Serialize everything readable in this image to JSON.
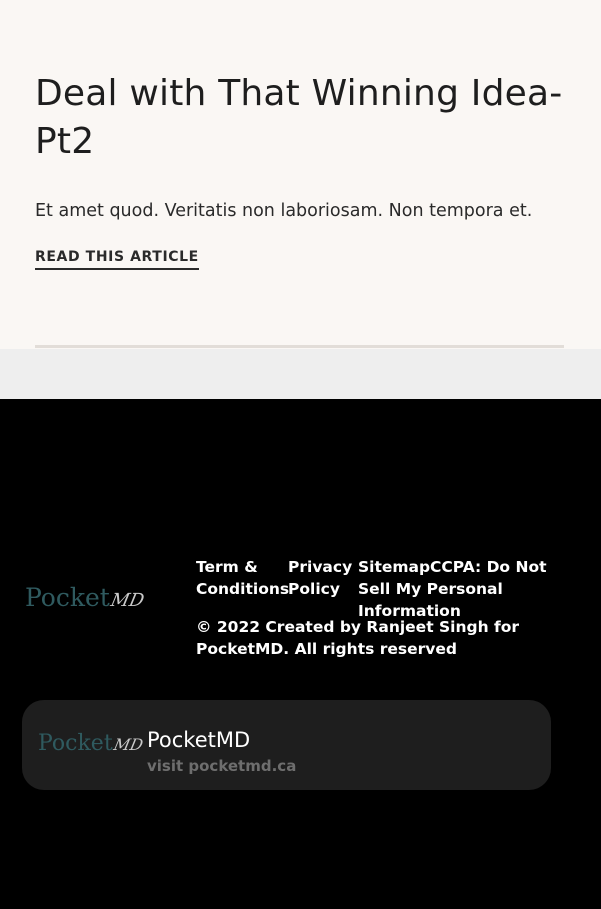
{
  "article": {
    "title": "Deal with That Winning Idea-Pt2",
    "excerpt": "Et amet quod. Veritatis non laboriosam. Non tempora et.",
    "read_link": "READ THIS ARTICLE"
  },
  "footer": {
    "logo": {
      "word": "Pocket",
      "mark": "MD"
    },
    "nav": {
      "terms": "Term & Conditions",
      "privacy": "Privacy Policy",
      "sitemap": "Sitemap",
      "ccpa": "CCPA: Do Not Sell My Personal Information"
    },
    "copyright": "© 2022 Created by Ranjeet Singh for PocketMD. All rights reserved"
  },
  "card": {
    "logo": {
      "word": "Pocket",
      "mark": "MD"
    },
    "title": "PocketMD",
    "subtitle": "visit pocketmd.ca"
  },
  "colors": {
    "article_background": "#faf7f4",
    "footer_background": "#000000",
    "card_background": "#1e1e1e",
    "logo_teal": "#2f5a5f"
  }
}
